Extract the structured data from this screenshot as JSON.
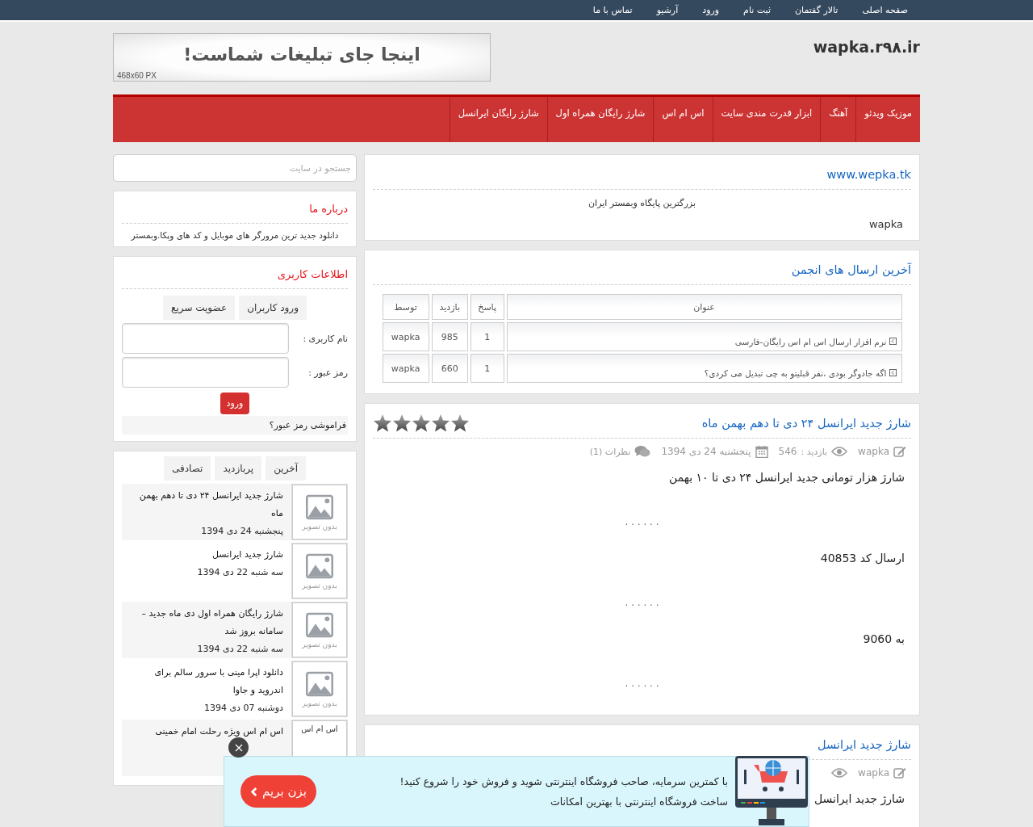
{
  "top_nav": [
    "صفحه اصلی",
    "تالار گفتمان",
    "ثبت نام",
    "ورود",
    "آرشیو",
    "تماس با ما"
  ],
  "header": {
    "logo": "wapka.r۹۸.ir",
    "ad_text": "اینجا جای تبلیغات شماست!",
    "ad_size": "468x60  PX"
  },
  "main_nav": [
    "موزیک ویدئو",
    "آهنگ",
    "ابزار قدرت مندی سایت",
    "اس ام اس",
    "شارژ رایگان همراه اول",
    "شارژ رایگان ایرانسل"
  ],
  "intro_panel": {
    "title": "www.wepka.tk",
    "tagline": "بزرگترین پایگاه وبمستر ایران",
    "author": "wapka"
  },
  "forum_panel": {
    "title": "آخرین ارسال های انجمن",
    "columns": [
      "عنوان",
      "پاسخ",
      "بازدید",
      "توسط"
    ],
    "rows": [
      [
        "نرم افزار ارسال اس ام اس رایگان-فارسی",
        "1",
        "985",
        "wapka"
      ],
      [
        "اگه جادوگر بودی ،نفر قبلیتو به چی تبدیل می کردی؟",
        "1",
        "660",
        "wapka"
      ]
    ]
  },
  "posts": [
    {
      "title": "شارژ جدید ایرانسل ۲۴ دی تا دهم بهمن ماه",
      "stars": 5,
      "author": "wapka",
      "views_label": "بازدید :",
      "views": "546",
      "date": "پنجشنبه 24 دی 1394",
      "comments": "نظرات (1)",
      "body": [
        {
          "kind": "text",
          "text": "شارژ هزار تومانی جدید ایرانسل ۲۴ دی تا ۱۰ بهمن"
        },
        {
          "kind": "dots",
          "text": ". . . . . ."
        },
        {
          "kind": "text",
          "text": "ارسال کد 40853"
        },
        {
          "kind": "dots",
          "text": ". . . . . ."
        },
        {
          "kind": "text",
          "text": "به 9060"
        },
        {
          "kind": "dots",
          "text": ". . . . . ."
        }
      ]
    },
    {
      "title": "شارژ جدید ایرانسل",
      "author": "wapka",
      "body": [
        {
          "kind": "text",
          "text": "شارژ جدید ایرانسل"
        }
      ]
    }
  ],
  "sidebar": {
    "search_placeholder": "جستجو در سایت",
    "about": {
      "title": "درباره ما",
      "text": "دانلود جدید ترین مرورگر های موبایل و کد های وپکا.وبمستر"
    },
    "user": {
      "title": "اطلاعات کاربری",
      "tabs": [
        "ورود کاربران",
        "عضویت سریع"
      ],
      "fields": [
        {
          "label": "نام کاربری :"
        },
        {
          "label": "رمز عبور :"
        }
      ],
      "submit": "ورود",
      "forgot": "فراموشی رمز عبور؟"
    },
    "post_list": {
      "tabs": [
        "آخرین",
        "پربازدید",
        "تصادفی"
      ],
      "items": [
        {
          "title": "شارژ جدید ایرانسل ۲۴ دی تا دهم بهمن ماه",
          "date": "پنجشنبه 24 دی 1394",
          "thumb": {
            "kind": "none",
            "label": "بدون تصویر"
          }
        },
        {
          "title": "شارژ جدید ایرانسل",
          "date": "سه شنبه 22 دی 1394",
          "thumb": {
            "kind": "none",
            "label": "بدون تصویر"
          }
        },
        {
          "title": "شارژ رایگان همراه اول دی ماه جدید – سامانه بروز شد",
          "date": "سه شنبه 22 دی 1394",
          "thumb": {
            "kind": "none",
            "label": "بدون تصویر"
          }
        },
        {
          "title": "دانلود اپرا مینی با سرور سالم برای اندروید و جاوا",
          "date": "دوشنبه 07 دی 1394",
          "thumb": {
            "kind": "none",
            "label": "بدون تصویر"
          }
        },
        {
          "title": "اس ام اس ویژه رحلت امام خمینی",
          "thumb": {
            "kind": "text",
            "label": "اس ام اس"
          }
        }
      ]
    }
  },
  "promo": {
    "lines": [
      "با کمترین سرمایه، صاحب فروشگاه اینترنتی شوید و فروش خود را شروع کنید!",
      "ساخت فروشگاه اینترنتی با بهترین امکانات"
    ],
    "button": "بزن بریم"
  }
}
